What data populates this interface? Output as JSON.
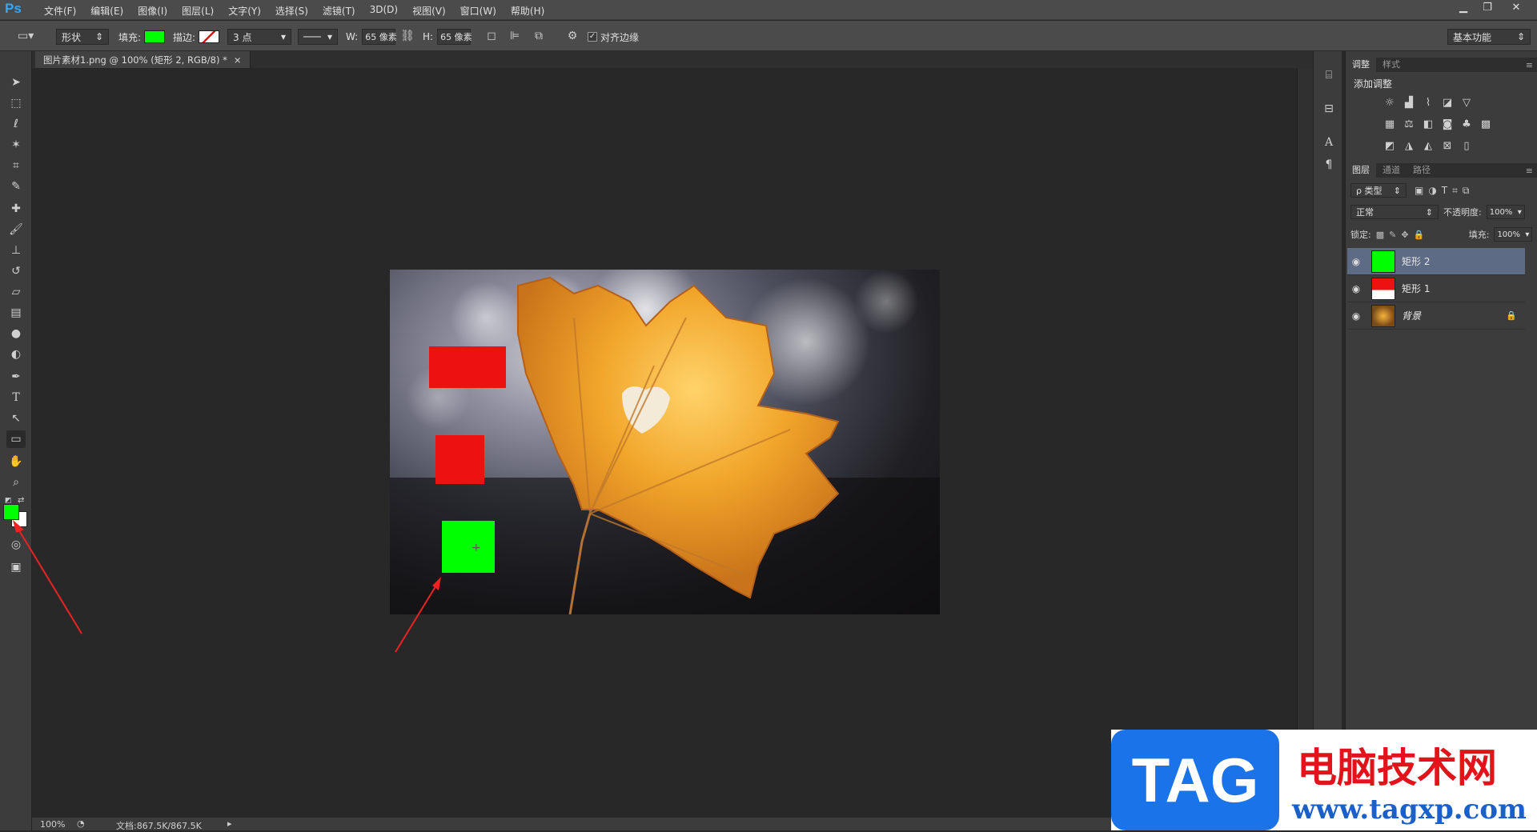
{
  "app": {
    "logo": "Ps"
  },
  "menu": [
    "文件(F)",
    "编辑(E)",
    "图像(I)",
    "图层(L)",
    "文字(Y)",
    "选择(S)",
    "滤镜(T)",
    "3D(D)",
    "视图(V)",
    "窗口(W)",
    "帮助(H)"
  ],
  "window_controls": {
    "minimize": "▁",
    "restore": "❐",
    "close": "✕"
  },
  "options": {
    "mode_label": "形状",
    "fill_label": "填充:",
    "fill_color": "#00ff00",
    "stroke_label": "描边:",
    "stroke_width": "3 点",
    "w_label": "W:",
    "w_value": "65 像素",
    "h_label": "H:",
    "h_value": "65 像素",
    "align_edges_label": "对齐边缘",
    "workspace": "基本功能"
  },
  "document": {
    "tab_title": "图片素材1.png @ 100% (矩形 2, RGB/8) *",
    "close": "×"
  },
  "canvas_shapes": [
    {
      "name": "red-rect-1",
      "color": "#ee1111"
    },
    {
      "name": "red-rect-2",
      "color": "#ee1111"
    },
    {
      "name": "green-rect",
      "color": "#00ff00"
    }
  ],
  "status": {
    "zoom": "100%",
    "doc_info": "文档:867.5K/867.5K"
  },
  "panels": {
    "adjust_tabs": [
      "调整",
      "样式"
    ],
    "adjust_title": "添加调整",
    "layers_tabs": [
      "图层",
      "通道",
      "路径"
    ],
    "filter_kind": "ρ 类型",
    "blend_mode": "正常",
    "opacity_label": "不透明度:",
    "opacity_value": "100%",
    "lock_label": "锁定:",
    "fill_label": "填充:",
    "fill_value": "100%"
  },
  "layers": [
    {
      "name": "矩形 2",
      "selected": true,
      "thumb_color": "#00ff00"
    },
    {
      "name": "矩形 1",
      "selected": false,
      "thumb_color": "#ee1111"
    },
    {
      "name": "背景",
      "selected": false,
      "thumb_color": "#d88a1a"
    }
  ],
  "foreground_color": "#00ff00",
  "background_color": "#ffffff",
  "watermark": {
    "logo_text": "TAG",
    "site_name": "电脑技术网",
    "url": "www.tagxp.com"
  }
}
